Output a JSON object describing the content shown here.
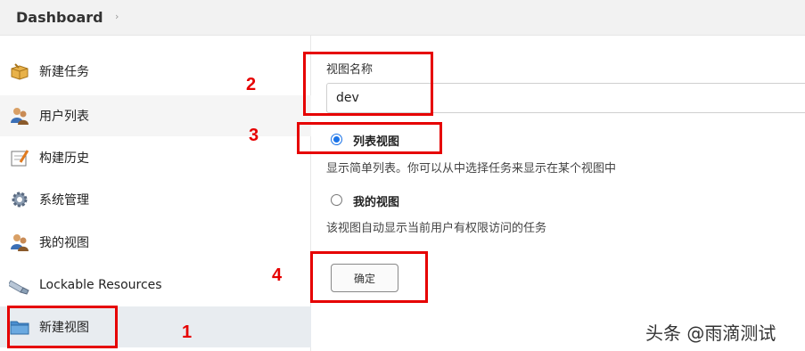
{
  "header": {
    "title": "Dashboard",
    "chevron": "›"
  },
  "sidebar": {
    "items": [
      {
        "label": "新建任务",
        "icon": "package-icon"
      },
      {
        "label": "用户列表",
        "icon": "users-icon"
      },
      {
        "label": "构建历史",
        "icon": "notepad-icon"
      },
      {
        "label": "系统管理",
        "icon": "gear-icon"
      },
      {
        "label": "我的视图",
        "icon": "user-icon"
      },
      {
        "label": "Lockable Resources",
        "icon": "usb-drive-icon"
      },
      {
        "label": "新建视图",
        "icon": "folder-icon"
      }
    ]
  },
  "form": {
    "view_name_label": "视图名称",
    "view_name_value": "dev",
    "options": [
      {
        "label": "列表视图",
        "description": "显示简单列表。你可以从中选择任务来显示在某个视图中",
        "selected": true
      },
      {
        "label": "我的视图",
        "description": "该视图自动显示当前用户有权限访问的任务",
        "selected": false
      }
    ],
    "ok_button": "确定"
  },
  "annotations": [
    "1",
    "2",
    "3",
    "4"
  ],
  "watermark": "头条 @雨滴测试",
  "colors": {
    "annotation": "#e60000",
    "radio_selected": "#1a73e8"
  }
}
